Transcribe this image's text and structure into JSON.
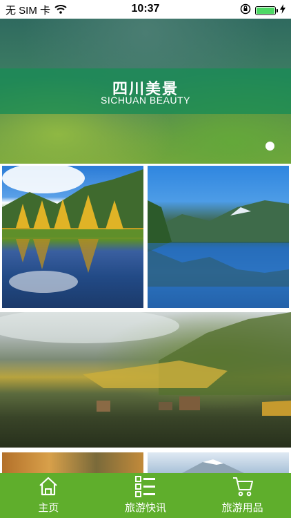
{
  "status_bar": {
    "carrier": "无 SIM 卡",
    "time": "10:37"
  },
  "banner": {
    "title": "四川美景",
    "subtitle": "SICHUAN BEAUTY"
  },
  "tab_bar": {
    "items": [
      {
        "label": "主页",
        "icon": "home-icon"
      },
      {
        "label": "旅游快讯",
        "icon": "list-icon"
      },
      {
        "label": "旅游用品",
        "icon": "cart-icon"
      }
    ]
  },
  "colors": {
    "tab_bar_bg": "#5fae2c",
    "banner_band": "#188c54",
    "battery": "#4cd964"
  }
}
